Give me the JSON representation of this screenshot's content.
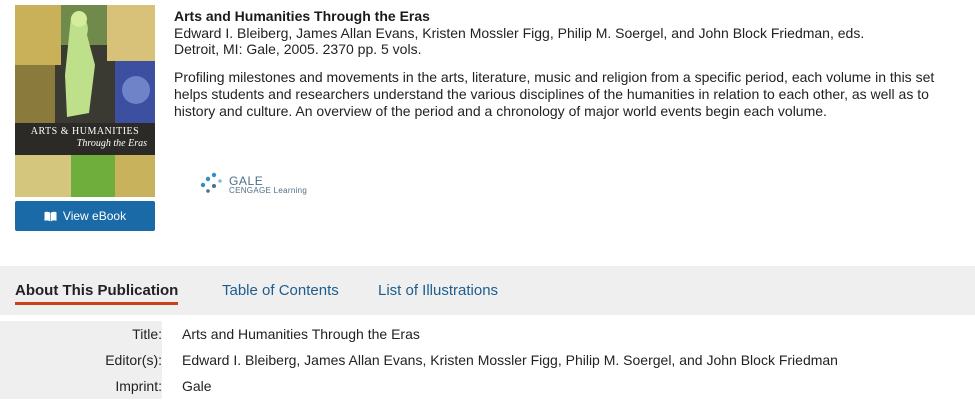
{
  "book": {
    "cover": {
      "title": "ARTS & HUMANITIES",
      "subtitle": "Through the Eras"
    },
    "view_ebook_label": "View eBook",
    "title": "Arts and Humanities Through the Eras",
    "editors_line": "Edward I. Bleiberg, James Allan Evans, Kristen Mossler Figg, Philip M. Soergel, and John Block Friedman, eds.",
    "publication_line": "Detroit, MI: Gale, 2005. 2370 pp. 5 vols.",
    "description": "Profiling milestones and movements in the arts, literature, music and religion from a specific period, each volume in this set helps students and researchers understand the various disciplines of the humanities in relation to each other, as well as to history and culture. An overview of the period and a chronology of major world events begin each volume.",
    "publisher_logo": {
      "top": "GALE",
      "bottom": "CENGAGE Learning"
    }
  },
  "tabs": [
    {
      "label": "About This Publication",
      "active": true
    },
    {
      "label": "Table of Contents",
      "active": false
    },
    {
      "label": "List of Illustrations",
      "active": false
    }
  ],
  "details": [
    {
      "label": "Title:",
      "value": "Arts and Humanities Through the Eras"
    },
    {
      "label": "Editor(s):",
      "value": "Edward I. Bleiberg, James Allan Evans, Kristen Mossler Figg, Philip M. Soergel, and John Block Friedman"
    },
    {
      "label": "Imprint:",
      "value": "Gale"
    }
  ],
  "colors": {
    "button": "#1a6aa8",
    "link": "#1d5d8e",
    "active_tab_underline": "#c8431a",
    "tab_bar": "#efefef"
  }
}
